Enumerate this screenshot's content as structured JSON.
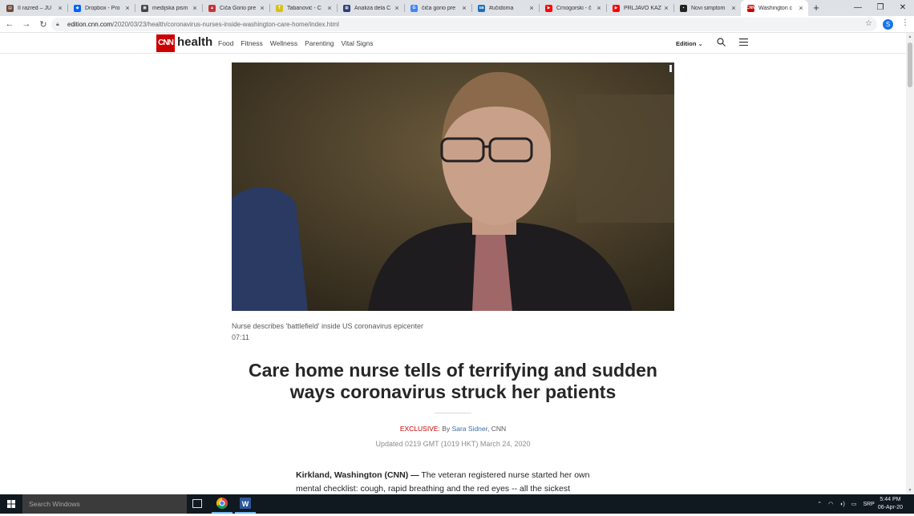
{
  "browser": {
    "tabs": [
      {
        "title": "II razred – JU",
        "color": "#6b4a3a",
        "glyph": "▤"
      },
      {
        "title": "Dropbox - Pro",
        "color": "#0061fe",
        "glyph": "◆"
      },
      {
        "title": "medijska pism",
        "color": "#444444",
        "glyph": "▣"
      },
      {
        "title": "Čiča Gorio pre",
        "color": "#cc3333",
        "glyph": "▲"
      },
      {
        "title": "Tabanović - C",
        "color": "#d4c21a",
        "glyph": "T"
      },
      {
        "title": "Analiza dela Č",
        "color": "#2a3d7a",
        "glyph": "▦"
      },
      {
        "title": "čiča gorio pre",
        "color": "#4285f4",
        "glyph": "G"
      },
      {
        "title": "#učidoma",
        "color": "#1f6fb5",
        "glyph": "ua"
      },
      {
        "title": "Crnogorski - č",
        "color": "#ff0000",
        "glyph": "▶"
      },
      {
        "title": "PRLJAVO KAZ",
        "color": "#ff0000",
        "glyph": "▶"
      },
      {
        "title": "Novi simptom",
        "color": "#222222",
        "glyph": "▪"
      },
      {
        "title": "Washington c",
        "color": "#cc0000",
        "glyph": "CNN",
        "active": true
      }
    ],
    "new_tab": "+",
    "close_glyph": "×",
    "url_host": "edition.cnn.com",
    "url_path": "/2020/03/23/health/coronavirus-nurses-inside-washington-care-home/index.html",
    "profile_initial": "S"
  },
  "site": {
    "logo": "CNN",
    "section": "health",
    "nav": [
      "Food",
      "Fitness",
      "Wellness",
      "Parenting",
      "Vital Signs"
    ],
    "edition_label": "Edition"
  },
  "article": {
    "video_caption": "Nurse describes 'battlefield' inside US coronavirus epicenter",
    "video_duration": "07:11",
    "headline": "Care home nurse tells of terrifying and sudden ways coronavirus struck her patients",
    "byline_exclusive": "EXCLUSIVE:",
    "byline_by": " By ",
    "byline_author": "Sara Sidner",
    "byline_outlet": ", CNN",
    "updated": "Updated 0219 GMT (1019 HKT) March 24, 2020",
    "dateline": "Kirkland, Washington (CNN) —",
    "body": " The veteran registered nurse started her own mental checklist: cough, rapid breathing and the red eyes -- all the sickest"
  },
  "taskbar": {
    "search_placeholder": "Search Windows",
    "language": "SRP",
    "time": "5:44 PM",
    "date": "06-Apr-20"
  }
}
